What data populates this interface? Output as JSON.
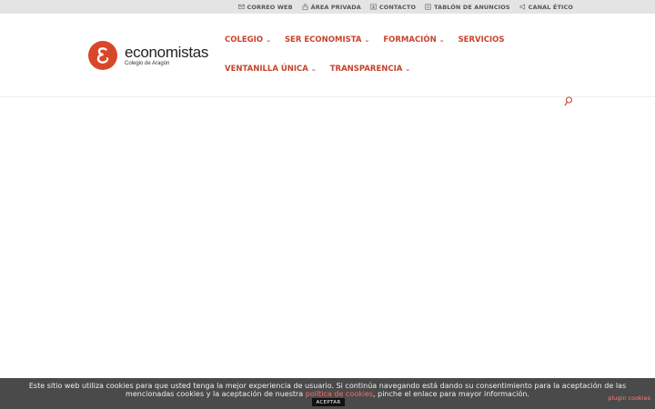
{
  "topbar": {
    "links": [
      {
        "label": "CORREO WEB",
        "icon": "mail-icon"
      },
      {
        "label": "ÁREA PRIVADA",
        "icon": "lock-icon"
      },
      {
        "label": "CONTACTO",
        "icon": "contact-card-icon"
      },
      {
        "label": "TABLÓN DE ANUNCIOS",
        "icon": "board-icon"
      },
      {
        "label": "CANAL ÉTICO",
        "icon": "megaphone-icon"
      }
    ]
  },
  "logo": {
    "name": "economistas",
    "subtitle": "Colegio de Aragón",
    "color": "#d9472b"
  },
  "nav": {
    "row1": [
      {
        "label": "COLEGIO",
        "has_submenu": true
      },
      {
        "label": "SER ECONOMISTA",
        "has_submenu": true
      },
      {
        "label": "FORMACIÓN",
        "has_submenu": true
      },
      {
        "label": "SERVICIOS",
        "has_submenu": false
      }
    ],
    "row2": [
      {
        "label": "VENTANILLA ÚNICA",
        "has_submenu": true
      },
      {
        "label": "TRANSPARENCIA",
        "has_submenu": true
      }
    ],
    "accent": "#c7432a"
  },
  "cookie": {
    "text_before": "Este sitio web utiliza cookies para que usted tenga la mejor experiencia de usuario. Si continúa navegando está dando su consentimiento para la aceptación de las mencionadas cookies y la aceptación de nuestra ",
    "link": "política de cookies",
    "text_after": ", pinche el enlace para mayor información.",
    "accept": "ACEPTAR",
    "plugin": "plugin cookies"
  }
}
